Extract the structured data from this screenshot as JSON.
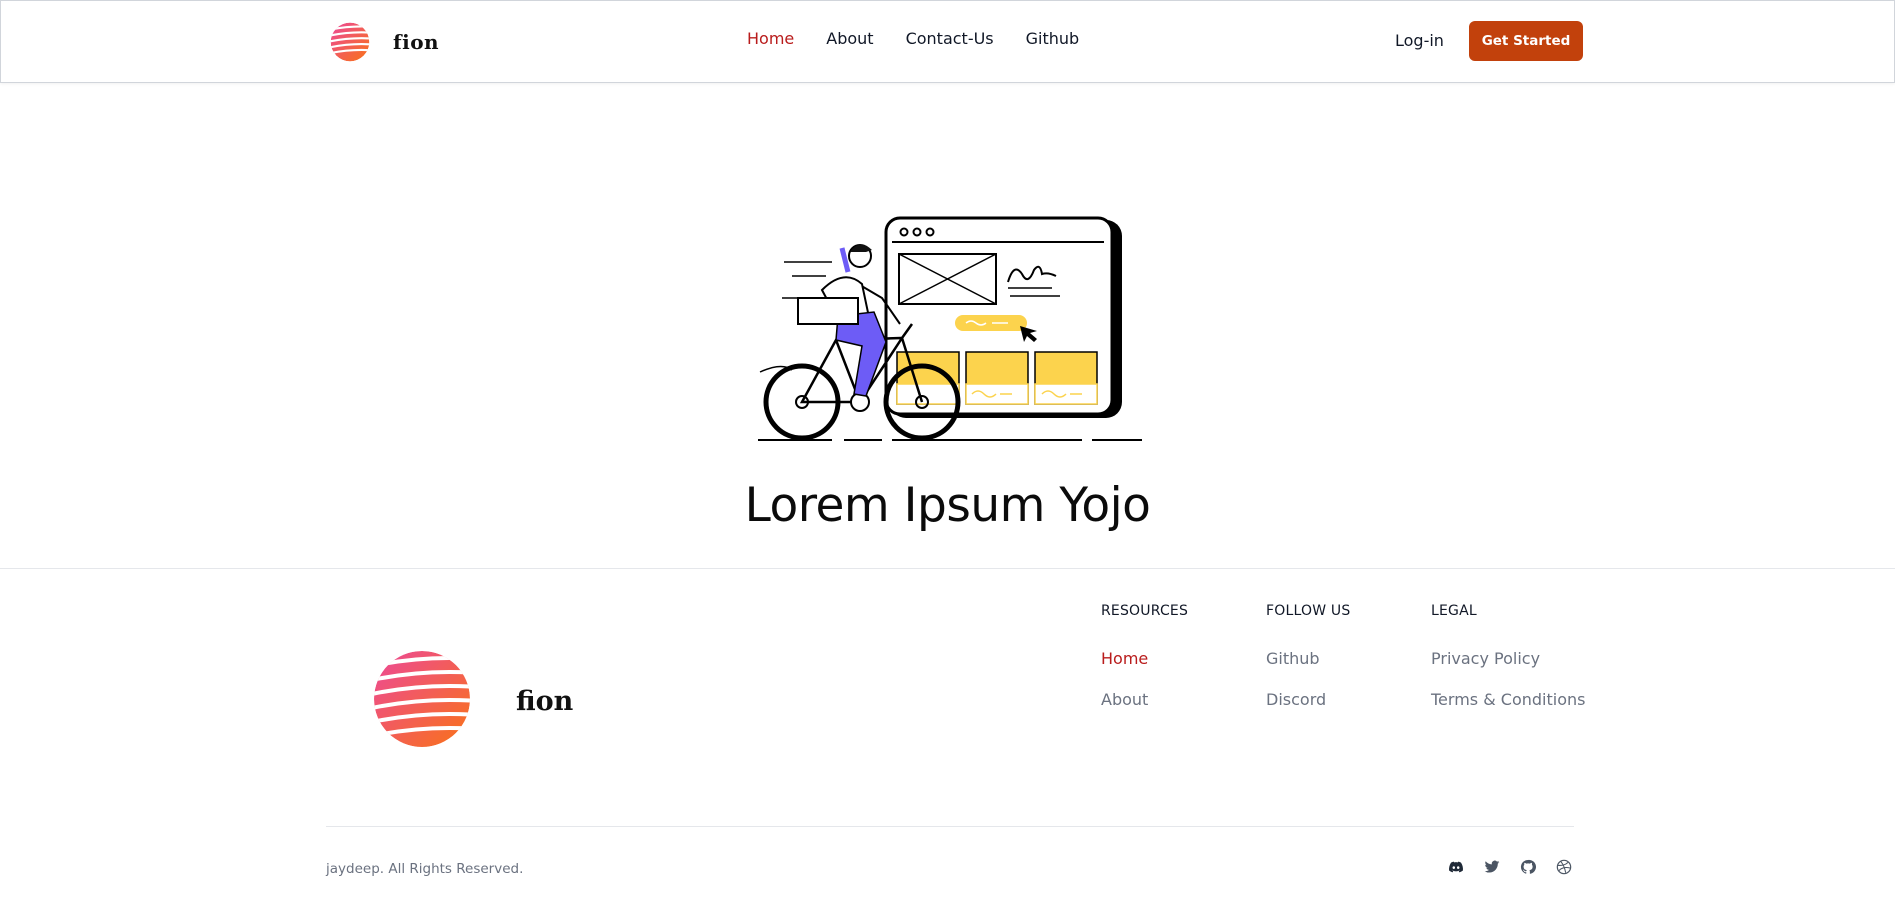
{
  "header": {
    "brand_name": "fion",
    "nav": [
      {
        "label": "Home",
        "active": true
      },
      {
        "label": "About",
        "active": false
      },
      {
        "label": "Contact-Us",
        "active": false
      },
      {
        "label": "Github",
        "active": false
      }
    ],
    "login_label": "Log-in",
    "cta_label": "Get Started"
  },
  "hero": {
    "title": "Lorem Ipsum Yojo"
  },
  "footer": {
    "brand_name": "fion",
    "columns": [
      {
        "heading": "RESOURCES",
        "links": [
          {
            "label": "Home",
            "active": true
          },
          {
            "label": "About",
            "active": false
          }
        ]
      },
      {
        "heading": "FOLLOW US",
        "links": [
          {
            "label": "Github",
            "active": false
          },
          {
            "label": "Discord",
            "active": false
          }
        ]
      },
      {
        "heading": "LEGAL",
        "links": [
          {
            "label": "Privacy Policy",
            "active": false
          },
          {
            "label": "Terms & Conditions",
            "active": false
          }
        ]
      }
    ],
    "copyright": "jaydeep. All Rights Reserved.",
    "social_icons": [
      "discord-icon",
      "twitter-icon",
      "github-icon",
      "dribbble-icon"
    ]
  },
  "colors": {
    "accent_red": "#b91c1c",
    "cta_orange": "#c2410c",
    "illustration_yellow": "#fcd34d",
    "illustration_purple": "#6d5cf6",
    "logo_gradient_start": "#ec4899",
    "logo_gradient_end": "#f97316"
  }
}
